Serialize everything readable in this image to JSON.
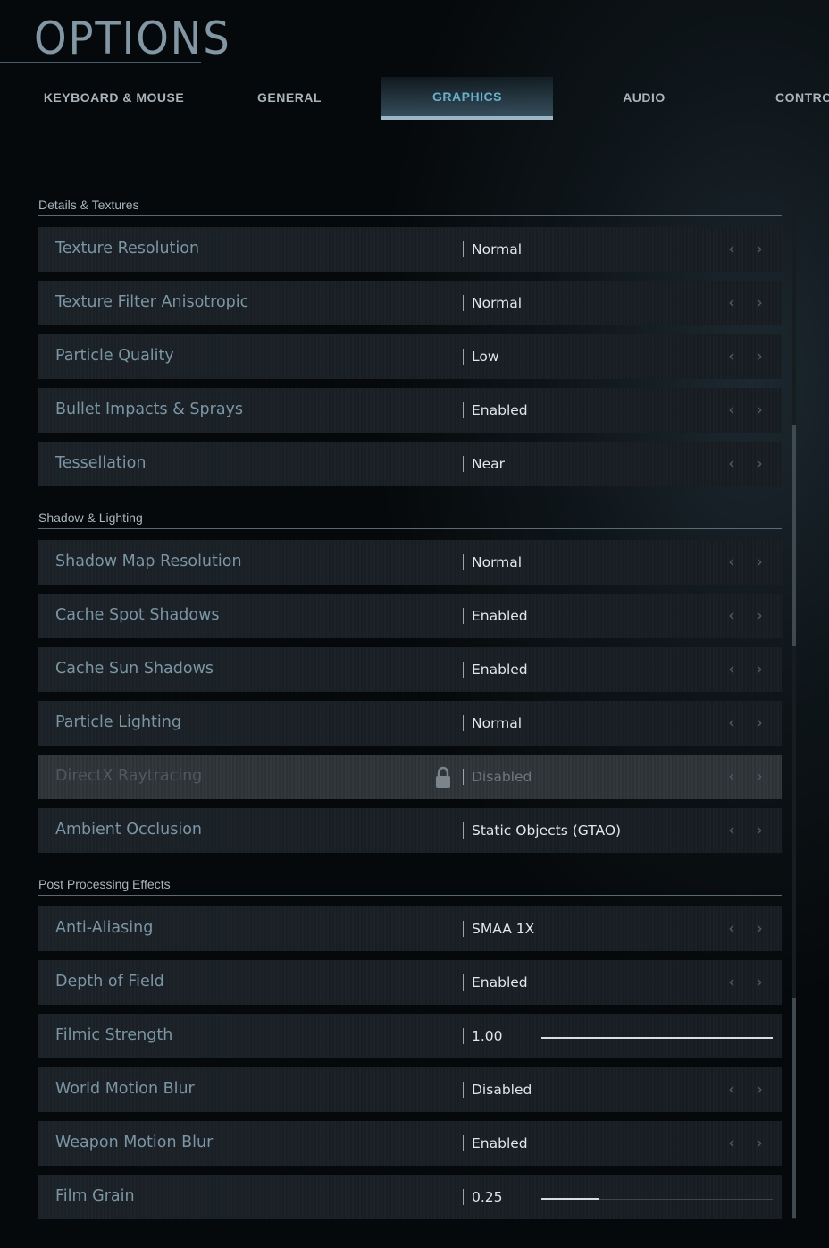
{
  "header": {
    "title": "OPTIONS"
  },
  "tabs": [
    {
      "label": "KEYBOARD & MOUSE",
      "active": false
    },
    {
      "label": "GENERAL",
      "active": false
    },
    {
      "label": "GRAPHICS",
      "active": true
    },
    {
      "label": "AUDIO",
      "active": false
    },
    {
      "label": "CONTRO",
      "active": false
    }
  ],
  "sections": [
    {
      "title": "Details & Textures",
      "rows": [
        {
          "label": "Texture Resolution",
          "value": "Normal",
          "control": "selector"
        },
        {
          "label": "Texture Filter Anisotropic",
          "value": "Normal",
          "control": "selector"
        },
        {
          "label": "Particle Quality",
          "value": "Low",
          "control": "selector"
        },
        {
          "label": "Bullet Impacts & Sprays",
          "value": "Enabled",
          "control": "selector"
        },
        {
          "label": "Tessellation",
          "value": "Near",
          "control": "selector"
        }
      ]
    },
    {
      "title": "Shadow & Lighting",
      "rows": [
        {
          "label": "Shadow Map Resolution",
          "value": "Normal",
          "control": "selector"
        },
        {
          "label": "Cache Spot Shadows",
          "value": "Enabled",
          "control": "selector"
        },
        {
          "label": "Cache Sun Shadows",
          "value": "Enabled",
          "control": "selector"
        },
        {
          "label": "Particle Lighting",
          "value": "Normal",
          "control": "selector"
        },
        {
          "label": "DirectX Raytracing",
          "value": "Disabled",
          "control": "selector",
          "locked": true
        },
        {
          "label": "Ambient Occlusion",
          "value": "Static Objects (GTAO)",
          "control": "selector"
        }
      ]
    },
    {
      "title": "Post Processing Effects",
      "rows": [
        {
          "label": "Anti-Aliasing",
          "value": "SMAA 1X",
          "control": "selector"
        },
        {
          "label": "Depth of Field",
          "value": "Enabled",
          "control": "selector"
        },
        {
          "label": "Filmic Strength",
          "value": "1.00",
          "control": "slider",
          "level": 1.0
        },
        {
          "label": "World Motion Blur",
          "value": "Disabled",
          "control": "selector"
        },
        {
          "label": "Weapon Motion Blur",
          "value": "Enabled",
          "control": "selector"
        },
        {
          "label": "Film Grain",
          "value": "0.25",
          "control": "slider",
          "level": 0.25
        }
      ]
    }
  ],
  "icons": {
    "prev": "chevron-left-icon",
    "next": "chevron-right-icon",
    "lock": "lock-icon"
  },
  "colors": {
    "accent": "#6ab0cc",
    "label": "#7c95a4",
    "value": "#e1e6e9"
  }
}
